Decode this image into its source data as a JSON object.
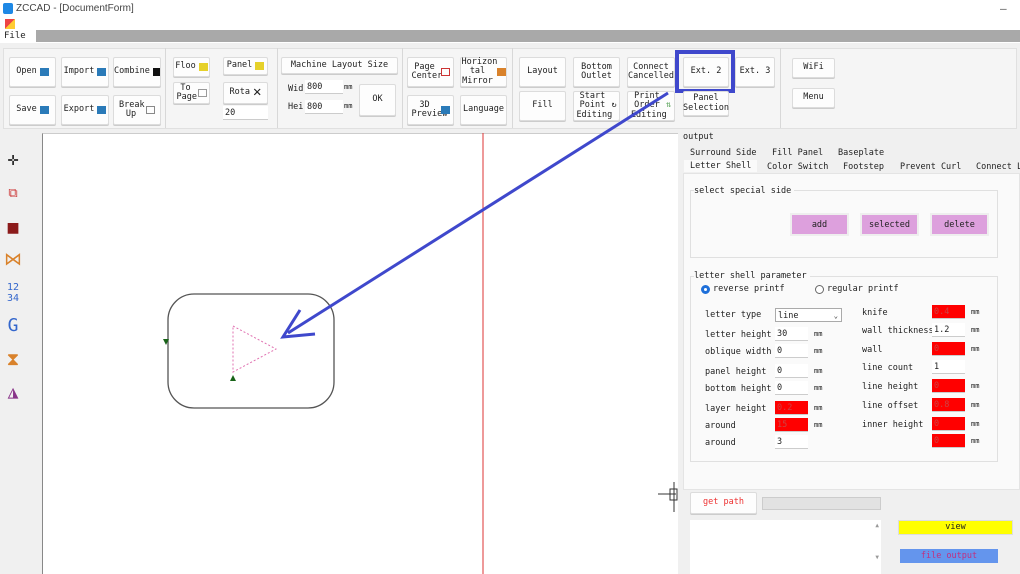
{
  "window": {
    "title": "ZCCAD - [DocumentForm]"
  },
  "menu": {
    "file": "File"
  },
  "toolbar": {
    "open": "Open",
    "import": "Import",
    "combine": "Combine",
    "save": "Save",
    "export": "Export",
    "break_up": "Break Up",
    "floor": "Floo",
    "to_page": "To Page",
    "panel": "Panel",
    "rota": "Rota",
    "rota_value": "20",
    "machine_layout_size": "Machine Layout Size",
    "width_label": "Wid",
    "width_value": "800",
    "height_label": "Hei",
    "height_value": "800",
    "unit": "mm",
    "ok": "OK",
    "page_center": "Page Center",
    "horizontal_mirror": "Horizon tal Mirror",
    "preview_3d": "3D Preview",
    "language": "Language",
    "layout": "Layout",
    "bottom_outlet": "Bottom Outlet",
    "connect_cancelled": "Connect Cancelled",
    "ext2": "Ext. 2",
    "ext3": "Ext. 3",
    "fill": "Fill",
    "start_point_editing": "Start Point Editing",
    "print_order_editing": "Print Order Editing",
    "panel_selection": "Panel Selection",
    "wifi": "WiFi",
    "menu": "Menu"
  },
  "panel": {
    "output": "output",
    "tabs_row1": [
      "Surround Side",
      "Fill Panel",
      "Baseplate"
    ],
    "tabs_row2": [
      "Letter Shell",
      "Color Switch",
      "Footstep",
      "Prevent Curl",
      "Connect Le"
    ],
    "active_tab": "Letter Shell",
    "special_side": {
      "title": "select special side",
      "add": "add",
      "selected": "selected",
      "delete": "delete"
    },
    "params": {
      "title": "letter shell parameter",
      "reverse": "reverse printf",
      "regular": "regular printf",
      "mode": "reverse",
      "unit": "mm",
      "left": [
        {
          "label": "letter type",
          "value": "line",
          "type": "select"
        },
        {
          "label": "letter height",
          "value": "30",
          "unit": true
        },
        {
          "label": "oblique width",
          "value": "0",
          "unit": true
        },
        {
          "label": "panel height",
          "value": "0",
          "unit": true
        },
        {
          "label": "bottom height",
          "value": "0",
          "unit": true
        },
        {
          "label": "layer height",
          "value": "0.2",
          "unit": true,
          "red": true
        },
        {
          "label": "around",
          "value": "15",
          "unit": true,
          "red": true
        },
        {
          "label": "around",
          "value": "3",
          "unit": false
        }
      ],
      "right": [
        {
          "label": "knife",
          "value": "0.4",
          "red": true,
          "unit": true
        },
        {
          "label": "wall thickness",
          "value": "1.2",
          "unit": true
        },
        {
          "label": "wall",
          "value": "0",
          "red": true,
          "unit": true
        },
        {
          "label": "line count",
          "value": "1",
          "unit": false
        },
        {
          "label": "line height",
          "value": "0",
          "red": true,
          "unit": true
        },
        {
          "label": "line offset",
          "value": "0.8",
          "red": true,
          "unit": true
        },
        {
          "label": "inner height",
          "value": "0",
          "red": true,
          "unit": true
        },
        {
          "label": "",
          "value": "0",
          "red": true,
          "unit": true
        }
      ]
    },
    "get_path": "get path",
    "view": "view",
    "file_output": "file output"
  },
  "colors": {
    "highlight": "#3f48cc",
    "red": "#ff0000",
    "view": "#ffff00",
    "file_output": "#6495ed",
    "button": "#dda0dd"
  }
}
